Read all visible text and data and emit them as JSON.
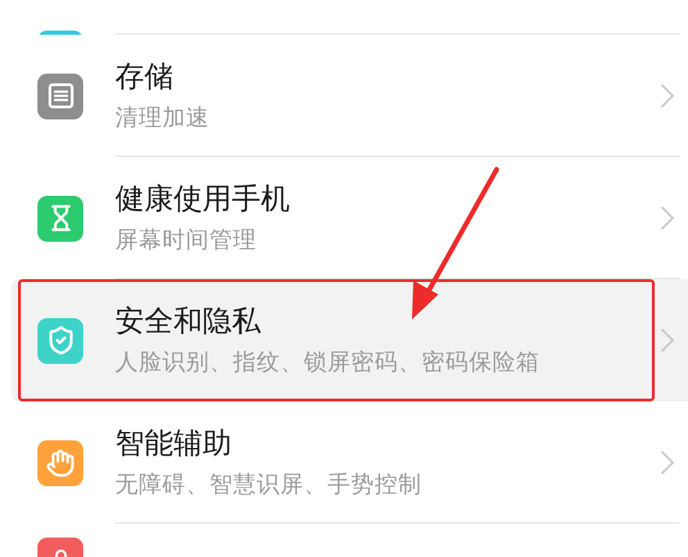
{
  "settings_items": [
    {
      "kind": "tail",
      "color": "#35c6e8",
      "highlighted": false
    },
    {
      "kind": "full",
      "color": "#8e8e8e",
      "title": "存储",
      "subtitle": "清理加速",
      "highlighted": false
    },
    {
      "kind": "full",
      "color": "#2dcb6f",
      "title": "健康使用手机",
      "subtitle": "屏幕时间管理",
      "highlighted": false
    },
    {
      "kind": "full",
      "color": "#3ed3c9",
      "title": "安全和隐私",
      "subtitle": "人脸识别、指纹、锁屏密码、密码保险箱",
      "highlighted": true
    },
    {
      "kind": "full",
      "color": "#ffa23c",
      "title": "智能辅助",
      "subtitle": "无障碍、智慧识屏、手势控制",
      "highlighted": false
    },
    {
      "kind": "head",
      "color": "#f25c5c",
      "highlighted": false
    }
  ]
}
